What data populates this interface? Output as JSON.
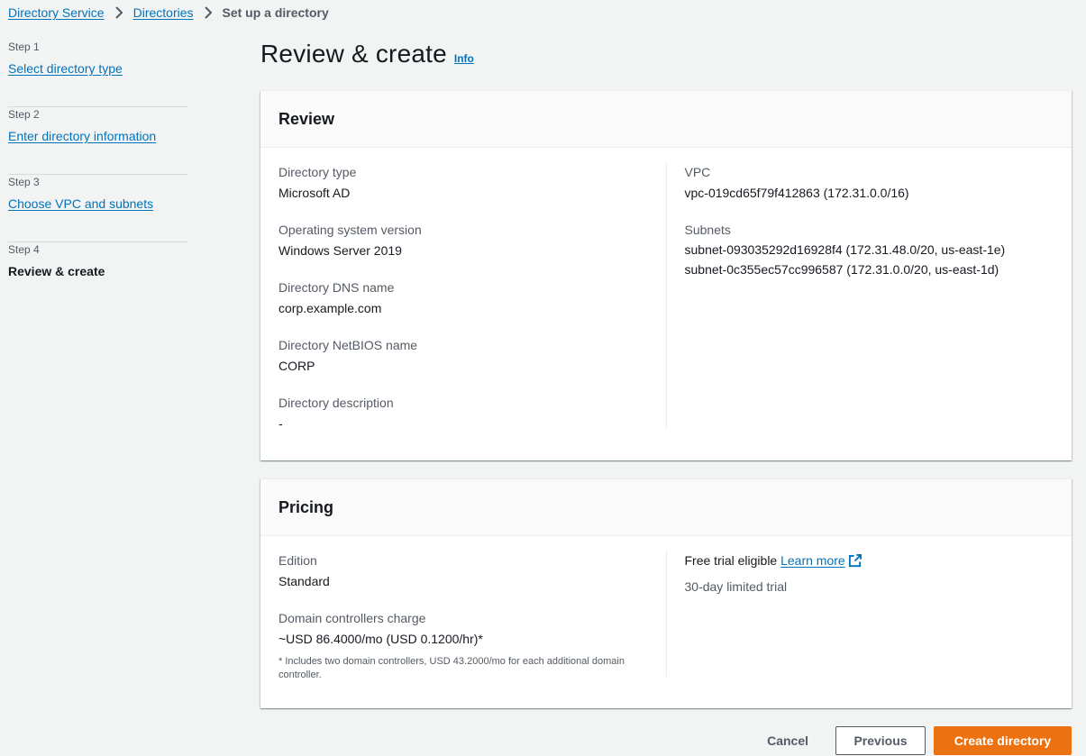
{
  "breadcrumb": {
    "items": [
      "Directory Service",
      "Directories"
    ],
    "current": "Set up a directory"
  },
  "steps": [
    {
      "num": "Step 1",
      "title": "Select directory type"
    },
    {
      "num": "Step 2",
      "title": "Enter directory information"
    },
    {
      "num": "Step 3",
      "title": "Choose VPC and subnets"
    },
    {
      "num": "Step 4",
      "title": "Review & create"
    }
  ],
  "page": {
    "title": "Review & create",
    "info": "Info"
  },
  "review": {
    "title": "Review",
    "directory_type_label": "Directory type",
    "directory_type": "Microsoft AD",
    "os_version_label": "Operating system version",
    "os_version": "Windows Server 2019",
    "dns_name_label": "Directory DNS name",
    "dns_name": "corp.example.com",
    "netbios_label": "Directory NetBIOS name",
    "netbios": "CORP",
    "description_label": "Directory description",
    "description": "-",
    "vpc_label": "VPC",
    "vpc": "vpc-019cd65f79f412863 (172.31.0.0/16)",
    "subnets_label": "Subnets",
    "subnets": [
      "subnet-093035292d16928f4 (172.31.48.0/20, us-east-1e)",
      "subnet-0c355ec57cc996587 (172.31.0.0/20, us-east-1d)"
    ]
  },
  "pricing": {
    "title": "Pricing",
    "edition_label": "Edition",
    "edition": "Standard",
    "charge_label": "Domain controllers charge",
    "charge": "~USD 86.4000/mo (USD 0.1200/hr)*",
    "footnote": "* Includes two domain controllers, USD 43.2000/mo for each additional domain controller.",
    "trial_label": "Free trial eligible",
    "learn_more": "Learn more",
    "trial_detail": "30-day limited trial"
  },
  "actions": {
    "cancel": "Cancel",
    "previous": "Previous",
    "create": "Create directory"
  },
  "colors": {
    "link": "#0073bb",
    "primary": "#ec7211",
    "background": "#f2f3f3"
  },
  "icons": {
    "breadcrumb_separator": "chevron-right-icon",
    "external_link": "external-link-icon"
  }
}
